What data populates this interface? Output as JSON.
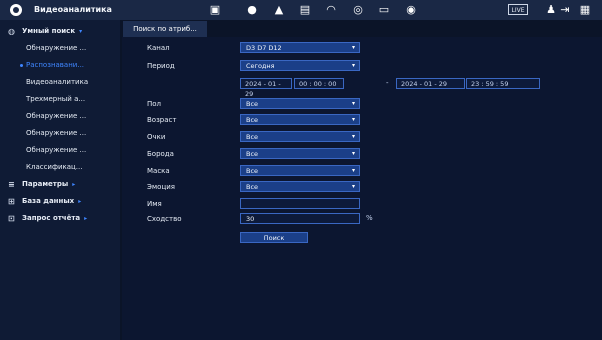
{
  "header": {
    "title": "Видеоаналитика",
    "live_label": "LIVE",
    "icons": [
      "app-logo-icon",
      "playback-icon",
      "search-icon",
      "alarm-icon",
      "storage-icon",
      "analytics-icon",
      "channel-icon",
      "monitor-icon",
      "speaker-icon",
      "user-icon",
      "logout-icon",
      "menu-icon"
    ]
  },
  "sidebar": {
    "items": [
      {
        "label": "Умный поиск",
        "type": "top"
      },
      {
        "label": "Обнаружение ...",
        "type": "sub"
      },
      {
        "label": "Распознавани...",
        "type": "sub-active"
      },
      {
        "label": "Видеоаналитика",
        "type": "sub"
      },
      {
        "label": "Трехмерный а...",
        "type": "sub"
      },
      {
        "label": "Обнаружение ...",
        "type": "sub"
      },
      {
        "label": "Обнаружение ...",
        "type": "sub"
      },
      {
        "label": "Обнаружение ...",
        "type": "sub"
      },
      {
        "label": "Классификац...",
        "type": "sub"
      },
      {
        "label": "Параметры",
        "type": "top"
      },
      {
        "label": "База данных",
        "type": "top"
      },
      {
        "label": "Запрос отчёта",
        "type": "top"
      }
    ]
  },
  "tab": {
    "label": "Поиск по атриб..."
  },
  "form": {
    "channel_label": "Канал",
    "channel_value": "D3 D7 D12",
    "period_label": "Период",
    "period_value": "Сегодня",
    "start_date": "2024 - 01 - 29",
    "start_time": "00 : 00 : 00",
    "dash": "-",
    "end_date": "2024 - 01 - 29",
    "end_time": "23 : 59 : 59",
    "fields": [
      {
        "label": "Пол",
        "value": "Все"
      },
      {
        "label": "Возраст",
        "value": "Все"
      },
      {
        "label": "Очки",
        "value": "Все"
      },
      {
        "label": "Борода",
        "value": "Все"
      },
      {
        "label": "Маска",
        "value": "Все"
      },
      {
        "label": "Эмоция",
        "value": "Все"
      }
    ],
    "name_label": "Имя",
    "name_value": "",
    "similarity_label": "Сходство",
    "similarity_value": "30",
    "percent": "%",
    "search_button": "Поиск"
  }
}
